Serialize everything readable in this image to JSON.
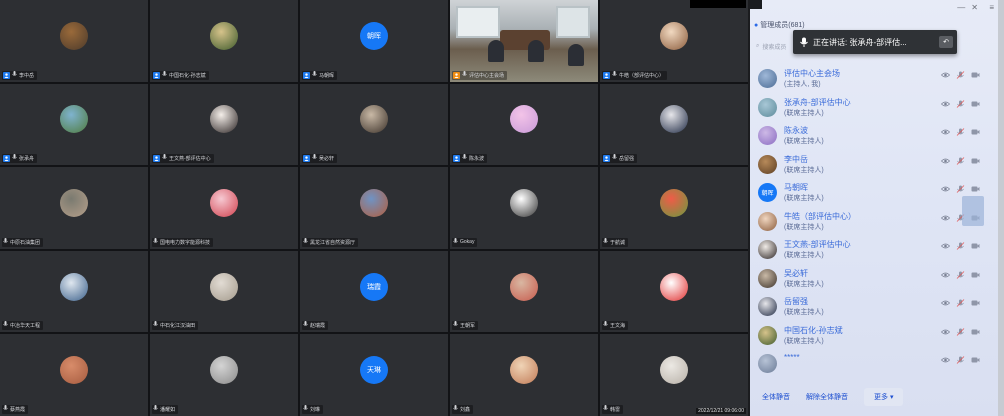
{
  "tiles": [
    {
      "name": "李中岳",
      "type": "photo",
      "colors": [
        "#9a6a3a",
        "#4c3a2b"
      ],
      "tag": "blue"
    },
    {
      "name": "中国石化-孙志斌",
      "type": "photo",
      "colors": [
        "#d6c38b",
        "#3d5a2b"
      ],
      "tag": "blue"
    },
    {
      "name": "马朝晖",
      "type": "text",
      "avatar_text": "朝晖",
      "tag": "blue"
    },
    {
      "name": "评估中心主会场",
      "type": "video",
      "tag": "orange"
    },
    {
      "name": "牛皓（部评估中心）",
      "type": "photo",
      "colors": [
        "#f1d9c1",
        "#8a5b3b"
      ],
      "tag": "blue"
    },
    {
      "name": "张承舟",
      "type": "photo",
      "colors": [
        "#7fb3cf",
        "#4f7b3e"
      ],
      "tag": "blue"
    },
    {
      "name": "王文燕-部评估中心",
      "type": "photo",
      "colors": [
        "#f4eee9",
        "#2b2424"
      ],
      "tag": "blue"
    },
    {
      "name": "吴必轩",
      "type": "photo",
      "colors": [
        "#c9b9a6",
        "#3b3129"
      ],
      "tag": "blue"
    },
    {
      "name": "陈永波",
      "type": "photo",
      "colors": [
        "#f3c4e8",
        "#c89ad8"
      ],
      "tag": "blue"
    },
    {
      "name": "岳留强",
      "type": "photo",
      "colors": [
        "#e6e6ea",
        "#1f2a44"
      ],
      "tag": "blue"
    },
    {
      "name": "中原石油集团",
      "type": "photo",
      "colors": [
        "#7a7a70",
        "#b59f8a"
      ],
      "tag": "none"
    },
    {
      "name": "国电电力数字能源科技",
      "type": "photo",
      "colors": [
        "#f6c9d2",
        "#d0404d"
      ],
      "tag": "none"
    },
    {
      "name": "黑龙江省自然资源厅",
      "type": "photo",
      "colors": [
        "#6f93c4",
        "#b25e3e"
      ],
      "tag": "none"
    },
    {
      "name": "Gokay",
      "type": "photo",
      "colors": [
        "#ffffff",
        "#333333"
      ],
      "tag": "none"
    },
    {
      "name": "于航诚",
      "type": "photo",
      "colors": [
        "#ef5c48",
        "#6a9b3f"
      ],
      "tag": "none"
    },
    {
      "name": "中冶华天工程",
      "type": "photo",
      "colors": [
        "#dfe7ef",
        "#3a5f8a"
      ],
      "tag": "none"
    },
    {
      "name": "中石化江汉油田",
      "type": "photo",
      "colors": [
        "#e2dcd4",
        "#a39a8c"
      ],
      "tag": "none"
    },
    {
      "name": "赵瑞霞",
      "type": "text",
      "avatar_text": "瑞霞",
      "tag": "none"
    },
    {
      "name": "王朝军",
      "type": "photo",
      "colors": [
        "#d9b7a2",
        "#c75a4c"
      ],
      "tag": "none"
    },
    {
      "name": "王文海",
      "type": "photo",
      "colors": [
        "#ffffff",
        "#e02e2e"
      ],
      "tag": "none"
    },
    {
      "name": "蔡燕霞",
      "type": "photo",
      "colors": [
        "#d88c6a",
        "#a55b3f"
      ],
      "tag": "none"
    },
    {
      "name": "潘耀如",
      "type": "photo",
      "colors": [
        "#d4d4d4",
        "#8a8a8a"
      ],
      "tag": "none"
    },
    {
      "name": "刘琳",
      "type": "text",
      "avatar_text": "天琳",
      "tag": "none"
    },
    {
      "name": "刘鑫",
      "type": "photo",
      "colors": [
        "#f0d4b6",
        "#c07a56"
      ],
      "tag": "none"
    },
    {
      "name": "韩雷",
      "type": "photo",
      "colors": [
        "#ece9e4",
        "#b7b0a7"
      ],
      "tag": "none"
    }
  ],
  "timestamp": "2022/12/21 09:06:00",
  "panel": {
    "title": "管理成员(681)",
    "controls": [
      "—",
      "✕",
      "≡"
    ],
    "search_placeholder": "搜索成员",
    "speaking_text": "正在讲话: 张承舟-部评估...",
    "members": [
      {
        "name": "评估中心主会场",
        "role": "(主持人, 我)",
        "avatar": "photo",
        "colors": [
          "#9fb8d8",
          "#4a6a94"
        ]
      },
      {
        "name": "张承舟-部评估中心",
        "role": "(联席主持人)",
        "avatar": "photo",
        "colors": [
          "#a8c7d6",
          "#5b8a9a"
        ]
      },
      {
        "name": "陈永波",
        "role": "(联席主持人)",
        "avatar": "photo",
        "colors": [
          "#cdb9e6",
          "#8a6cc2"
        ]
      },
      {
        "name": "李中岳",
        "role": "(联席主持人)",
        "avatar": "photo",
        "colors": [
          "#b78a5a",
          "#5b3d22"
        ]
      },
      {
        "name": "马朝晖",
        "role": "(联席主持人)",
        "avatar": "text",
        "avatar_text": "朝晖"
      },
      {
        "name": "牛皓（部评估中心）",
        "role": "(联席主持人)",
        "avatar": "photo",
        "colors": [
          "#f0d6c0",
          "#8a5b3b"
        ]
      },
      {
        "name": "王文燕-部评估中心",
        "role": "(联席主持人)",
        "avatar": "photo",
        "colors": [
          "#f0ebe6",
          "#2b2424"
        ]
      },
      {
        "name": "吴必轩",
        "role": "(联席主持人)",
        "avatar": "photo",
        "colors": [
          "#c9b9a6",
          "#3b3129"
        ]
      },
      {
        "name": "岳留强",
        "role": "(联席主持人)",
        "avatar": "photo",
        "colors": [
          "#e6e6ea",
          "#1f2a44"
        ]
      },
      {
        "name": "中国石化-孙志斌",
        "role": "(联席主持人)",
        "avatar": "photo",
        "colors": [
          "#d6c38b",
          "#3d5a2b"
        ]
      },
      {
        "name": "*****",
        "role": "",
        "avatar": "photo",
        "colors": [
          "#b7c3d6",
          "#6a7a96"
        ]
      }
    ],
    "mute_all": "全体静音",
    "unmute_all": "解除全体静音",
    "more": "更多 ▾"
  },
  "colors": {
    "accent": "#1678f6",
    "host_tag": "#f08d12",
    "link": "#1d4fd0"
  }
}
